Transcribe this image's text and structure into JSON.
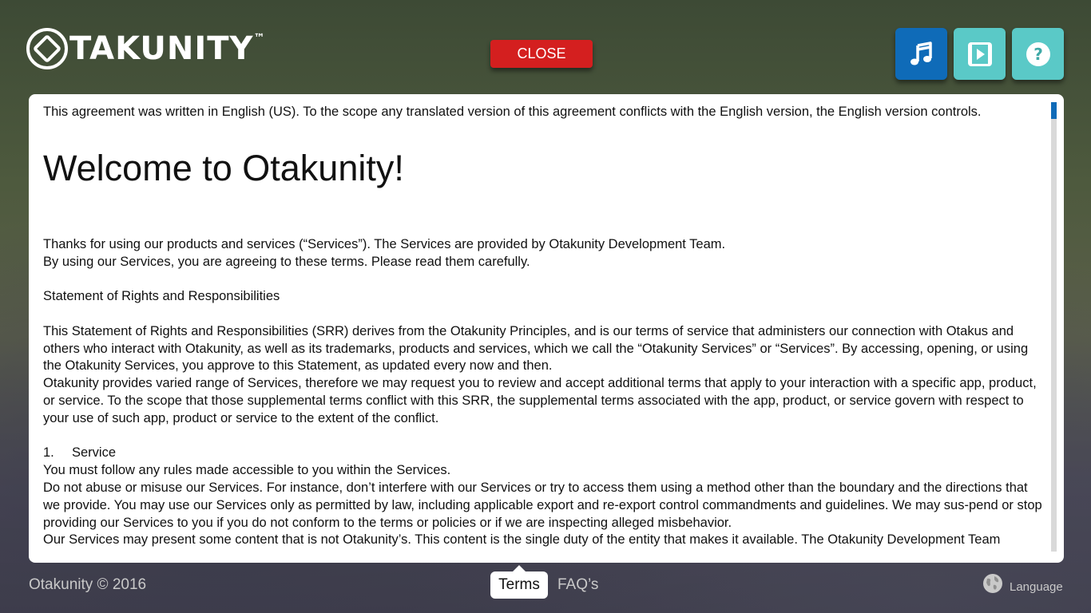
{
  "brand": {
    "name": "TAKUNITY",
    "trademark": "™"
  },
  "header": {
    "close_label": "CLOSE"
  },
  "top_icons": [
    {
      "name": "music-icon"
    },
    {
      "name": "play-video-icon"
    },
    {
      "name": "help-icon"
    }
  ],
  "terms": {
    "intro": "This agreement was written in English (US). To the scope any translated version of this agreement conflicts with the English version, the English version controls.",
    "heading": "Welcome to Otakunity!",
    "para1_line1": "Thanks for using our products and services (“Services”). The Services are provided by Otakunity Development Team.",
    "para1_line2": "By using our Services, you are agreeing to these terms. Please read them carefully.",
    "section_title": "Statement of Rights and Responsibilities",
    "para2": "This Statement of Rights and Responsibilities (SRR) derives from the Otakunity Principles, and is our terms of service that administers our connection with Otakus and others who interact with Otakunity, as well as its trademarks, products and services, which we call the “Otakunity Services” or “Services”. By accessing, opening, or using the Otakunity Services, you approve to this Statement, as updated every now and then.",
    "para3": "Otakunity provides varied range of Services, therefore we may request you to review and accept additional terms that apply to your interaction with a specific app, product, or service. To the scope that those supplemental terms conflict with this SRR, the supplemental terms associated with the app, product, or service govern with respect to your use of such app, product or service to the extent of the conflict.",
    "item1_number": "1.",
    "item1_title": "Service",
    "item1_line1": "You must follow any rules made accessible to you within the Services.",
    "item1_line2": "Do not abuse or misuse our Services. For instance, don’t interfere with our Services or try to access them using a method other than the boundary and the directions that we provide. You may use our Services only as permitted by law, including applicable export and re-export control commandments and guidelines. We may sus-pend or stop providing our Services to you if you do not conform to the terms or policies or if we are inspecting alleged misbehavior.",
    "item1_line3": "Our Services may present some content that is not Otakunity’s. This content is the single duty of the entity that makes it available. The Otakunity Development Team"
  },
  "footer": {
    "copyright": "Otakunity © 2016",
    "tab_terms": "Terms",
    "tab_faq": "FAQ’s",
    "language_label": "Language"
  },
  "colors": {
    "close": "#d41f1f",
    "music_button": "#0f6bb8",
    "teal_button": "#5ac9c7",
    "scroll_thumb": "#0f6bb8"
  }
}
